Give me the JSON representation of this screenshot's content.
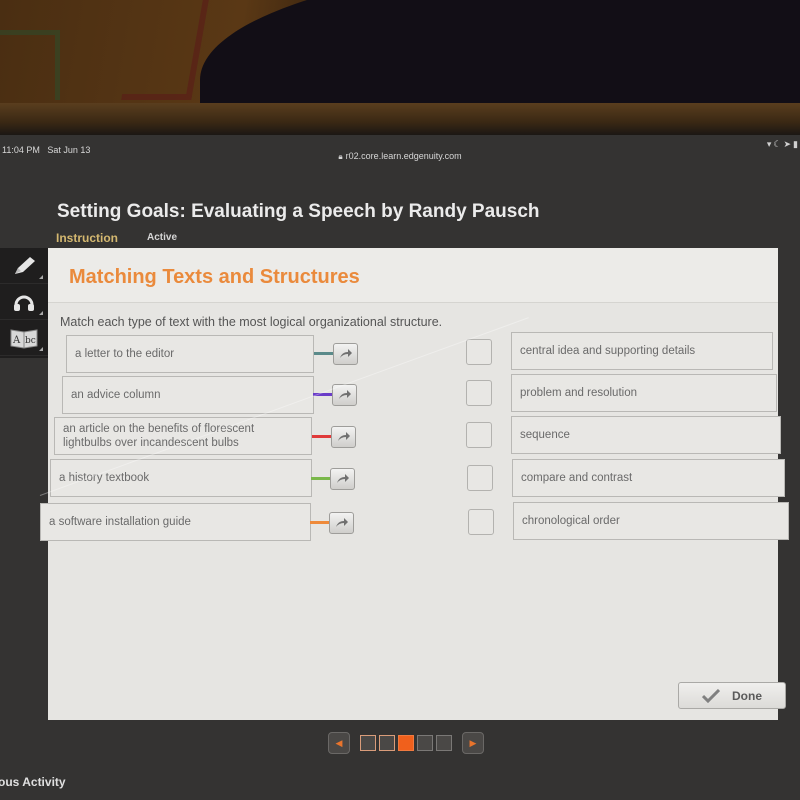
{
  "status_bar": {
    "time": "11:04 PM",
    "date": "Sat Jun 13",
    "url": "r02.core.learn.edgenuity.com",
    "icons": [
      "wifi-icon",
      "moon-icon",
      "location-icon",
      "battery-icon"
    ]
  },
  "course": {
    "title": "Setting Goals: Evaluating a Speech by Randy Pausch",
    "tabs": [
      {
        "label": "Instruction",
        "selected": true
      },
      {
        "label": "Active",
        "selected": false
      }
    ]
  },
  "toolbar": {
    "tools": [
      {
        "name": "pencil-icon",
        "label": "Notes"
      },
      {
        "name": "headphones-icon",
        "label": "Read Aloud"
      },
      {
        "name": "dictionary-icon",
        "label": "Dictionary"
      }
    ]
  },
  "activity": {
    "title": "Matching Texts and Structures",
    "instructions": "Match each type of text with the most logical organizational structure.",
    "items": [
      {
        "text": "a letter to the editor",
        "color": "#5a8a8a"
      },
      {
        "text": "an advice column",
        "color": "#6a3cc8"
      },
      {
        "text": "an article on the benefits of florescent lightbulbs over incandescent bulbs",
        "color": "#e03a3a"
      },
      {
        "text": "a history textbook",
        "color": "#7ab84a"
      },
      {
        "text": "a software installation guide",
        "color": "#ee8a3a"
      }
    ],
    "answers": [
      {
        "text": "central idea and supporting details"
      },
      {
        "text": "problem and resolution"
      },
      {
        "text": "sequence"
      },
      {
        "text": "compare and contrast"
      },
      {
        "text": "chronological order"
      }
    ],
    "done_label": "Done"
  },
  "pager": {
    "pages": [
      {
        "state": "visited"
      },
      {
        "state": "visited"
      },
      {
        "state": "current"
      },
      {
        "state": "unvisited"
      },
      {
        "state": "unvisited"
      }
    ]
  },
  "footer": {
    "prev_activity_label": "ous Activity"
  }
}
